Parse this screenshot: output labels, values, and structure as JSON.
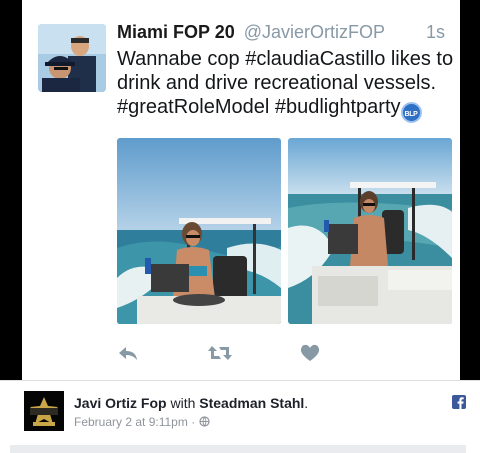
{
  "tweet": {
    "display_name": "Miami FOP 20",
    "handle": "@JavierOrtizFOP",
    "timestamp": "1s",
    "text": "Wannabe cop #claudiaCastillo likes to drink and drive recreational vessels. #greatRoleModel #budlightparty",
    "badge_text": "BLP"
  },
  "post": {
    "author": "Javi Ortiz Fop",
    "with_word": "with",
    "tagged": "Steadman Stahl",
    "period": ".",
    "date": "February 2 at 9:11pm",
    "separator": "·",
    "page_logo_text": "LT ROBERT ESSER POLICE"
  },
  "icons": {
    "reply": "reply-icon",
    "retweet": "retweet-icon",
    "like": "heart-icon",
    "facebook": "facebook-icon",
    "privacy": "globe-icon"
  },
  "colors": {
    "twitter_gray": "#8899a6",
    "facebook_blue": "#3b5998",
    "badge_blue": "#2f6fc4"
  }
}
